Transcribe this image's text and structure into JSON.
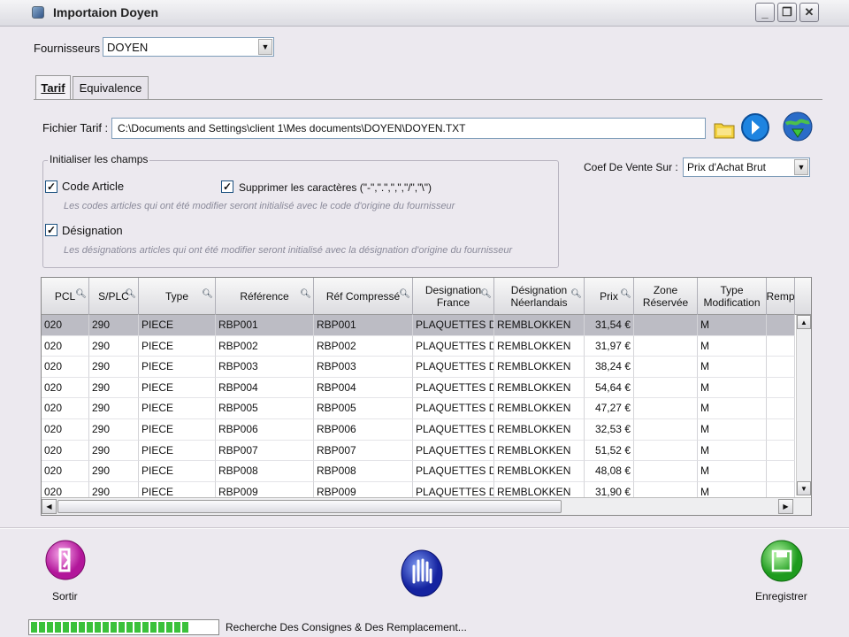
{
  "window": {
    "title": "Importaion Doyen"
  },
  "fournisseur": {
    "label": "Fournisseurs :",
    "value": "DOYEN"
  },
  "tabs": [
    {
      "label": "Tarif",
      "active": true
    },
    {
      "label": "Equivalence",
      "active": false
    }
  ],
  "fichier": {
    "label": "Fichier Tarif :",
    "path": "C:\\Documents and Settings\\client 1\\Mes documents\\DOYEN\\DOYEN.TXT"
  },
  "init_group": {
    "title": "Initialiser les champs",
    "code_article": {
      "label": "Code Article",
      "checked": true,
      "hint": "Les codes articles qui ont été modifier seront initialisé avec le code d'origine du fournisseur"
    },
    "designation": {
      "label": "Désignation",
      "checked": true,
      "hint": "Les désignations articles qui ont été modifier seront initialisé avec la désignation d'origine du fournisseur"
    },
    "supprimer": {
      "label": "Supprimer les caractères (\"-\",\".\",\",\",\"/\",\"\\\")",
      "checked": true
    }
  },
  "coef": {
    "label": "Coef De Vente Sur :",
    "value": "Prix d'Achat Brut"
  },
  "grid": {
    "columns": [
      "PCL",
      "S/PLC",
      "Type",
      "Référence",
      "Réf Compressé",
      "Designation\nFrance",
      "Désignation\nNéerlandais",
      "Prix",
      "Zone\nRéservée",
      "Type\nModification",
      "Remp"
    ],
    "rows": [
      [
        "020",
        "290",
        "PIECE",
        "RBP001",
        "RBP001",
        "PLAQUETTES DE",
        "REMBLOKKEN",
        "31,54 €",
        "",
        "M"
      ],
      [
        "020",
        "290",
        "PIECE",
        "RBP002",
        "RBP002",
        "PLAQUETTES DE",
        "REMBLOKKEN",
        "31,97 €",
        "",
        "M"
      ],
      [
        "020",
        "290",
        "PIECE",
        "RBP003",
        "RBP003",
        "PLAQUETTES DE",
        "REMBLOKKEN",
        "38,24 €",
        "",
        "M"
      ],
      [
        "020",
        "290",
        "PIECE",
        "RBP004",
        "RBP004",
        "PLAQUETTES DE",
        "REMBLOKKEN",
        "54,64 €",
        "",
        "M"
      ],
      [
        "020",
        "290",
        "PIECE",
        "RBP005",
        "RBP005",
        "PLAQUETTES DE",
        "REMBLOKKEN",
        "47,27 €",
        "",
        "M"
      ],
      [
        "020",
        "290",
        "PIECE",
        "RBP006",
        "RBP006",
        "PLAQUETTES DE",
        "REMBLOKKEN",
        "32,53 €",
        "",
        "M"
      ],
      [
        "020",
        "290",
        "PIECE",
        "RBP007",
        "RBP007",
        "PLAQUETTES DE",
        "REMBLOKKEN",
        "51,52 €",
        "",
        "M"
      ],
      [
        "020",
        "290",
        "PIECE",
        "RBP008",
        "RBP008",
        "PLAQUETTES DE",
        "REMBLOKKEN",
        "48,08 €",
        "",
        "M"
      ],
      [
        "020",
        "290",
        "PIECE",
        "RBP009",
        "RBP009",
        "PLAQUETTES DE",
        "REMBLOKKEN",
        "31,90 €",
        "",
        "M"
      ]
    ]
  },
  "buttons": {
    "sortir": "Sortir",
    "enregistrer": "Enregistrer"
  },
  "status": {
    "text": "Recherche Des Consignes & Des Remplacement...",
    "progress": 0.85
  },
  "colors": {
    "sortir": "#d12fb8",
    "enregistrer": "#3cc43c",
    "center": "#2b3fc8",
    "selected_row": "#bcbcc4"
  }
}
